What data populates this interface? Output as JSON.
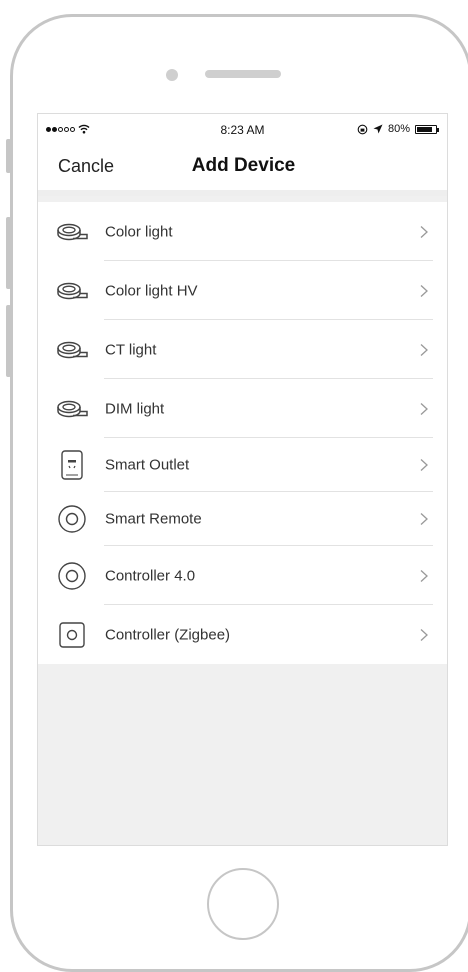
{
  "status_bar": {
    "time": "8:23 AM",
    "battery": "80%"
  },
  "nav": {
    "cancel_label": "Cancle",
    "title": "Add Device"
  },
  "devices": [
    {
      "label": "Color light",
      "icon": "led-strip-icon"
    },
    {
      "label": "Color light HV",
      "icon": "led-strip-icon"
    },
    {
      "label": "CT light",
      "icon": "led-strip-icon"
    },
    {
      "label": "DIM light",
      "icon": "led-strip-icon"
    },
    {
      "label": "Smart Outlet",
      "icon": "outlet-icon"
    },
    {
      "label": "Smart Remote",
      "icon": "remote-circle-icon"
    },
    {
      "label": "Controller 4.0",
      "icon": "controller-circle-icon"
    },
    {
      "label": "Controller (Zigbee)",
      "icon": "zigbee-controller-icon"
    }
  ]
}
